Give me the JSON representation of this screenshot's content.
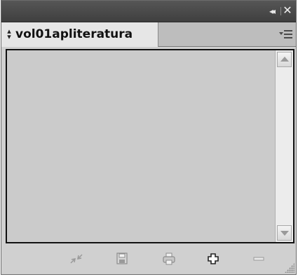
{
  "titlebar": {
    "collapse_icon": "double-chevron-left-icon",
    "close_icon": "close-icon",
    "collapse_glyph": "◂◂",
    "close_glyph": "✕"
  },
  "tab": {
    "sort_icon": "up-down-arrows-icon",
    "label": "vol01apliteratura",
    "menu_icon": "panel-menu-icon"
  },
  "content": {
    "scroll_up_icon": "scroll-up-arrow-icon",
    "scroll_down_icon": "scroll-down-arrow-icon"
  },
  "toolbar": {
    "icons": [
      "collapse-expand-arrows-icon",
      "save-icon",
      "print-icon",
      "add-icon",
      "remove-icon"
    ],
    "resize_grip_icon": "resize-grip-icon"
  },
  "colors": {
    "titlebar": "#4a4a4a",
    "tab_active": "#e6e6e6",
    "panel": "#d0d0d0",
    "content": "#cbcbcb"
  }
}
